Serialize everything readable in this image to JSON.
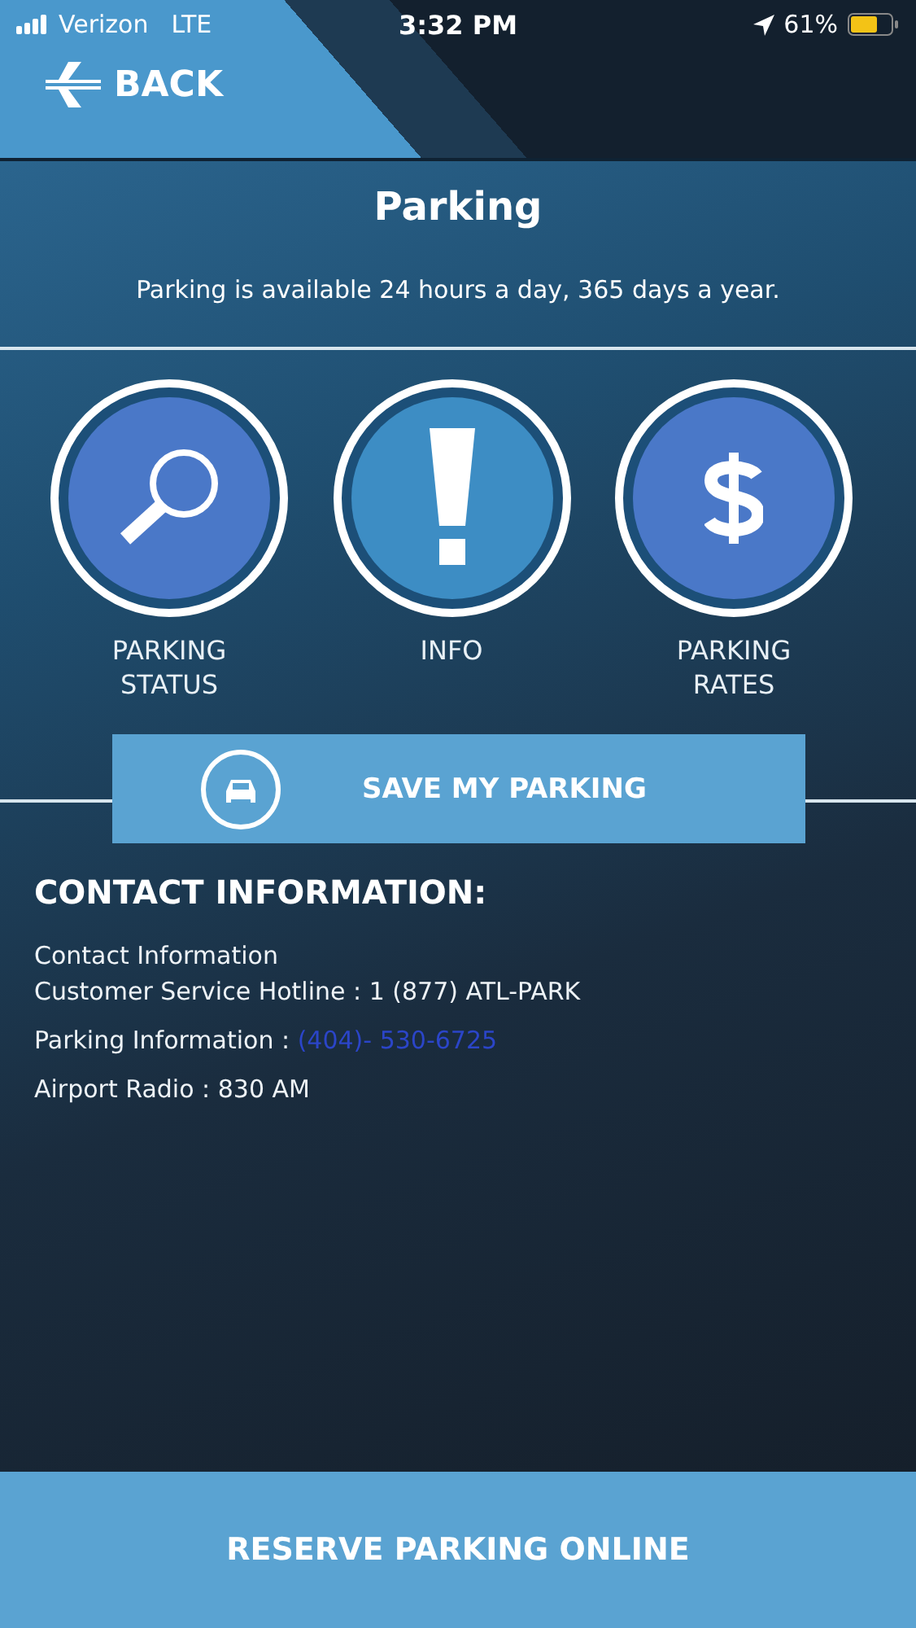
{
  "status_bar": {
    "carrier": "Verizon",
    "network": "LTE",
    "time": "3:32 PM",
    "battery": "61%"
  },
  "header": {
    "back": "BACK"
  },
  "title": "Parking",
  "subtitle": "Parking is available 24 hours a day, 365 days a year.",
  "tiles": [
    {
      "kind": "search",
      "label": "PARKING STATUS"
    },
    {
      "kind": "info",
      "label": "INFO"
    },
    {
      "kind": "dollar",
      "label": "PARKING RATES"
    }
  ],
  "save_button": "SAVE MY PARKING",
  "contact": {
    "heading": "CONTACT INFORMATION:",
    "lines": [
      {
        "text": "Contact Information"
      },
      {
        "text": "Customer Service Hotline : 1 (877) ATL-PARK"
      },
      {
        "text": "Parking Information :",
        "link": "(404)- 530-6725"
      },
      {
        "text": "Airport Radio :  830 AM"
      }
    ]
  },
  "reserve_button": "RESERVE PARKING ONLINE"
}
